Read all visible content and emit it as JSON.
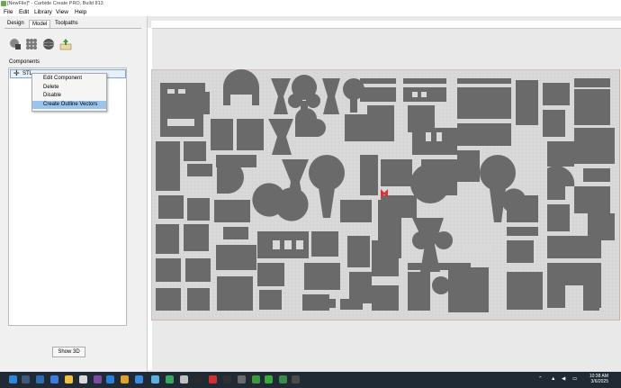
{
  "title": "[NewFile]* - Carbide Create PRO, Build 813",
  "menu": [
    "File",
    "Edit",
    "Library",
    "View",
    "Help"
  ],
  "tabs": [
    "Design",
    "Model",
    "Toolpaths"
  ],
  "tools": [
    "add-model-icon",
    "texture-icon",
    "sphere-icon",
    "import-icon"
  ],
  "components": {
    "label": "Components",
    "items": [
      {
        "name": "STL"
      }
    ]
  },
  "context_menu": [
    "Edit Component",
    "Delete",
    "Disable",
    "Create Outline Vectors"
  ],
  "show_3d": "Show 3D",
  "taskbar": {
    "time": "10:38 AM",
    "date": "3/6/2025"
  },
  "colors": {
    "part_fill": "#6a6a6a",
    "stock_bg": "#d9d9d9",
    "selected_menu": "#9cc3ea"
  }
}
